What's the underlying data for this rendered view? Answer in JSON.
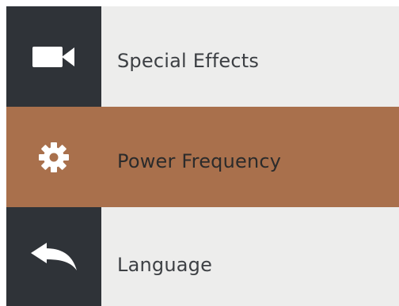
{
  "menu": {
    "items": [
      {
        "label": "Special Effects",
        "icon": "video-camera-icon",
        "active": false
      },
      {
        "label": "Power Frequency",
        "icon": "gear-icon",
        "active": true
      },
      {
        "label": "Language",
        "icon": "back-arrow-icon",
        "active": false
      }
    ]
  },
  "colors": {
    "icon_background": "#2f3338",
    "label_background": "#ededec",
    "active_background": "#a9704c",
    "text": "#3d4044",
    "icon": "#ffffff"
  }
}
